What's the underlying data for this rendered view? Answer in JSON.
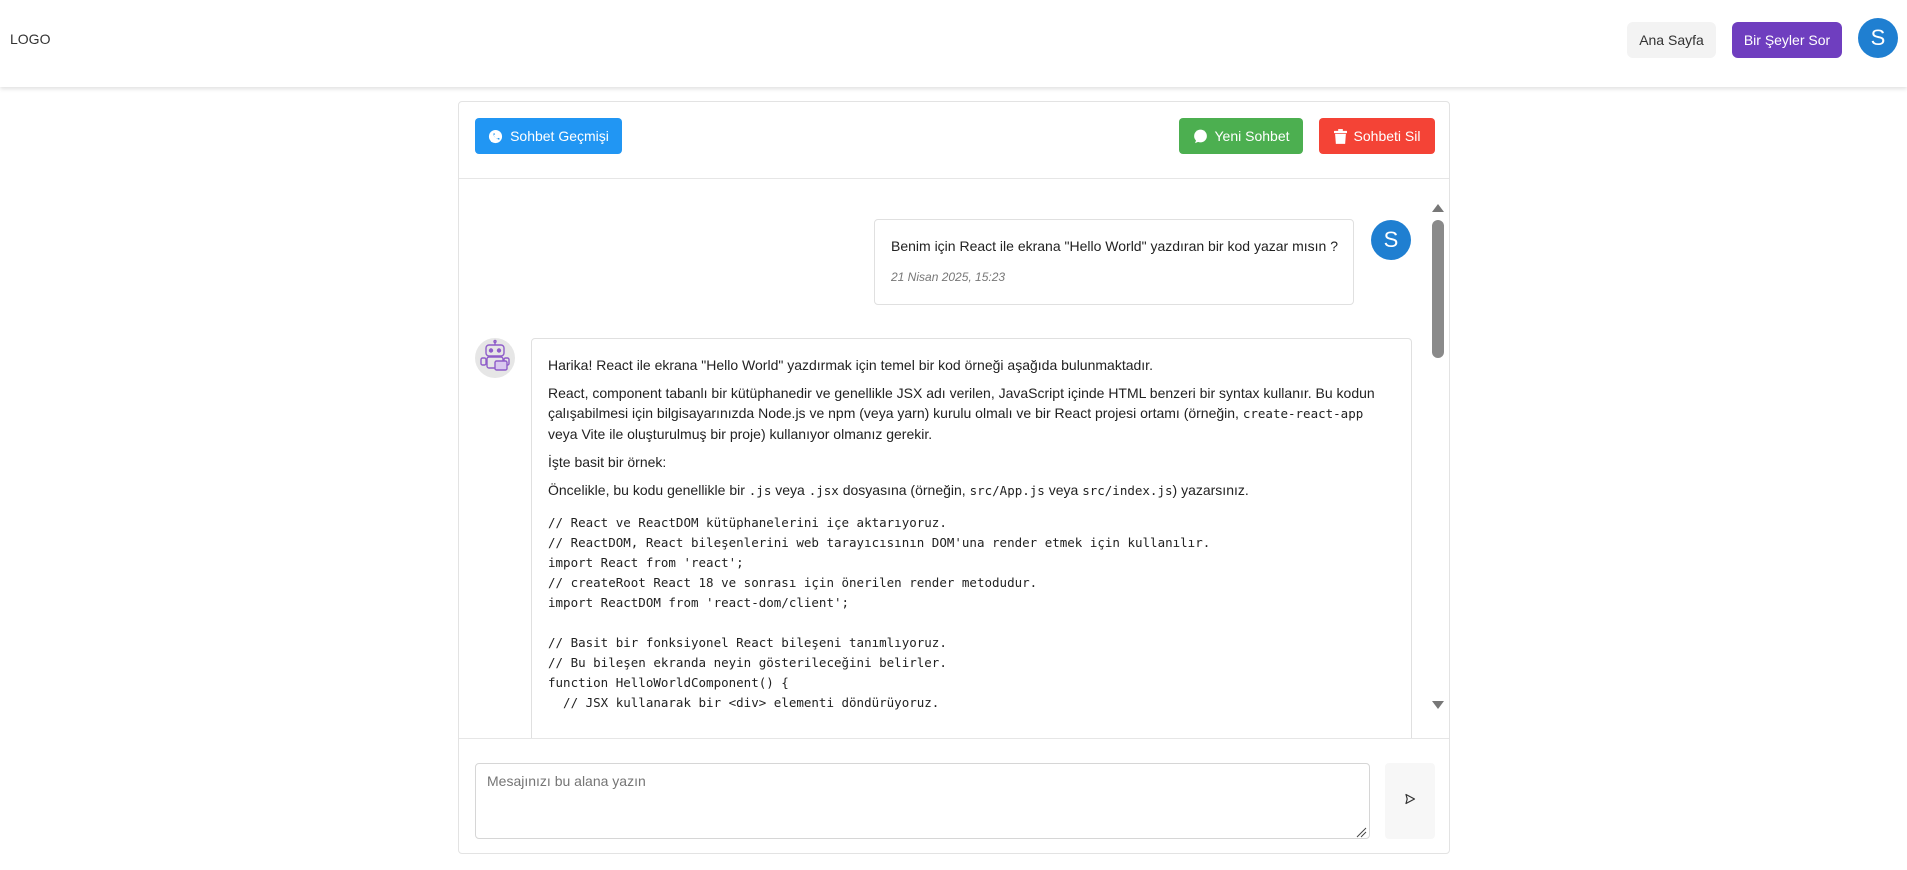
{
  "header": {
    "logo": "LOGO",
    "nav": {
      "home_label": "Ana Sayfa",
      "ask_label": "Bir Şeyler Sor"
    },
    "avatar_initial": "S"
  },
  "toolbar": {
    "history_label": "Sohbet Geçmişi",
    "new_chat_label": "Yeni Sohbet",
    "delete_chat_label": "Sohbeti Sil"
  },
  "conversation": {
    "user_message": {
      "text": "Benim için React ile ekrana \"Hello World\" yazdıran bir kod yazar mısın ?",
      "timestamp": "21 Nisan 2025, 15:23",
      "avatar_initial": "S"
    },
    "bot_message": {
      "p1": "Harika! React ile ekrana \"Hello World\" yazdırmak için temel bir kod örneği aşağıda bulunmaktadır.",
      "p2_a": "React, component tabanlı bir kütüphanedir ve genellikle JSX adı verilen, JavaScript içinde HTML benzeri bir syntax kullanır. Bu kodun çalışabilmesi için bilgisayarınızda Node.js ve npm (veya yarn) kurulu olmalı ve bir React projesi ortamı (örneğin, ",
      "p2_code": "create-react-app",
      "p2_b": " veya Vite ile oluşturulmuş bir proje) kullanıyor olmanız gerekir.",
      "p3": "İşte basit bir örnek:",
      "p4_a": "Öncelikle, bu kodu genellikle bir ",
      "p4_code1": ".js",
      "p4_b": " veya ",
      "p4_code2": ".jsx",
      "p4_c": " dosyasına (örneğin, ",
      "p4_code3": "src/App.js",
      "p4_d": " veya ",
      "p4_code4": "src/index.js",
      "p4_e": ") yazarsınız.",
      "code": "// React ve ReactDOM kütüphanelerini içe aktarıyoruz.\n// ReactDOM, React bileşenlerini web tarayıcısının DOM'una render etmek için kullanılır.\nimport React from 'react';\n// createRoot React 18 ve sonrası için önerilen render metodudur.\nimport ReactDOM from 'react-dom/client';\n\n// Basit bir fonksiyonel React bileşeni tanımlıyoruz.\n// Bu bileşen ekranda neyin gösterileceğini belirler.\nfunction HelloWorldComponent() {\n  // JSX kullanarak bir <div> elementi döndürüyoruz."
    }
  },
  "composer": {
    "placeholder": "Mesajınızı bu alana yazın",
    "value": ""
  },
  "colors": {
    "brand_purple": "#6f3ebf",
    "avatar_blue": "#1f7fd1",
    "history_blue": "#2196f3",
    "new_green": "#4caf50",
    "delete_red": "#f44336"
  },
  "icons": {
    "history": "chat-bubble-icon",
    "new_chat": "chat-bubble-icon",
    "delete": "trash-icon",
    "bot": "robot-icon",
    "send": "send-icon"
  }
}
